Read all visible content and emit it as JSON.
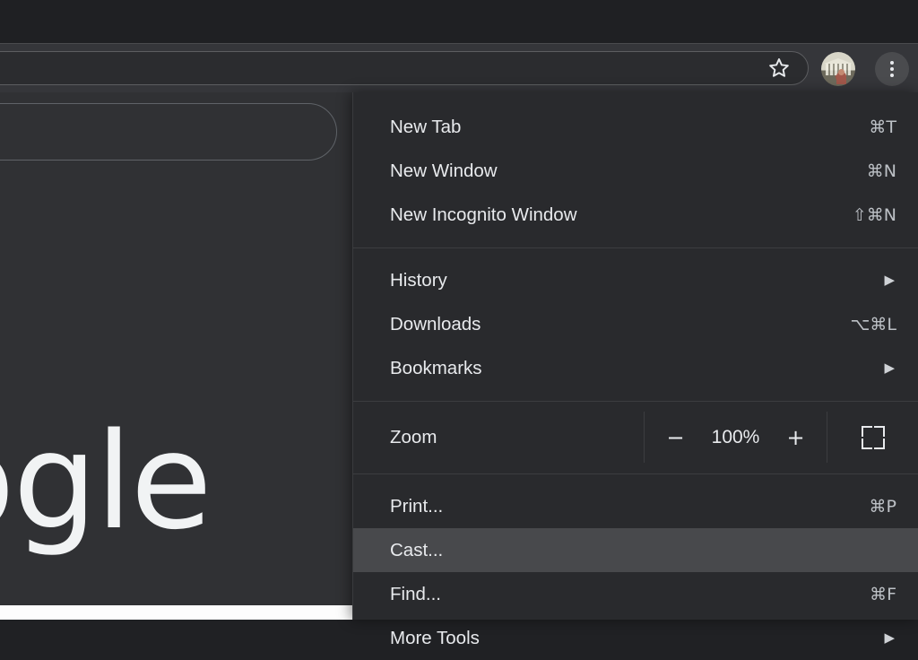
{
  "browser": {
    "toolbar": {
      "bookmark_star_icon": "star-icon",
      "profile_avatar": "avatar",
      "menu_button_icon": "three-dot-menu-icon"
    },
    "page": {
      "logo_text": "ogle",
      "searchbox_placeholder": ""
    }
  },
  "menu": {
    "groups": [
      {
        "items": [
          {
            "label": "New Tab",
            "shortcut": "⌘T",
            "submenu": false,
            "highlighted": false
          },
          {
            "label": "New Window",
            "shortcut": "⌘N",
            "submenu": false,
            "highlighted": false
          },
          {
            "label": "New Incognito Window",
            "shortcut": "⇧⌘N",
            "submenu": false,
            "highlighted": false
          }
        ]
      },
      {
        "items": [
          {
            "label": "History",
            "shortcut": "",
            "submenu": true,
            "highlighted": false
          },
          {
            "label": "Downloads",
            "shortcut": "⌥⌘L",
            "submenu": false,
            "highlighted": false
          },
          {
            "label": "Bookmarks",
            "shortcut": "",
            "submenu": true,
            "highlighted": false
          }
        ]
      },
      {
        "items": [
          {
            "label": "Print...",
            "shortcut": "⌘P",
            "submenu": false,
            "highlighted": false
          },
          {
            "label": "Cast...",
            "shortcut": "",
            "submenu": false,
            "highlighted": true
          },
          {
            "label": "Find...",
            "shortcut": "⌘F",
            "submenu": false,
            "highlighted": false
          },
          {
            "label": "More Tools",
            "shortcut": "",
            "submenu": true,
            "highlighted": false
          }
        ]
      }
    ],
    "zoom_row": {
      "label": "Zoom",
      "decrease_label": "−",
      "level": "100%",
      "increase_label": "+",
      "fullscreen_icon": "fullscreen-icon"
    },
    "submenu_arrow_glyph": "▶"
  },
  "colors": {
    "menu_background": "#292a2d",
    "menu_highlight": "#48494c",
    "toolbar_background": "#35363a",
    "tabstrip_background": "#1f2023",
    "page_background": "#303134",
    "text_primary": "#e8eaed",
    "text_secondary": "#bdc1c6"
  }
}
